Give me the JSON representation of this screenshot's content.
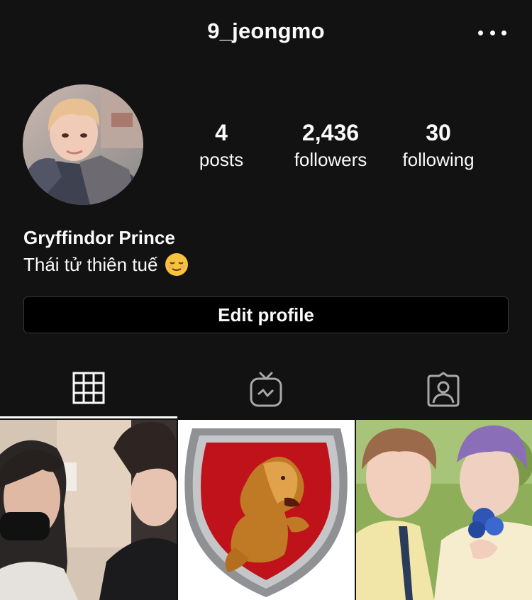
{
  "header": {
    "username": "9_jeongmo",
    "more_icon": "more-horizontal-icon"
  },
  "stats": {
    "posts": {
      "value": "4",
      "label": "posts"
    },
    "followers": {
      "value": "2,436",
      "label": "followers"
    },
    "following": {
      "value": "30",
      "label": "following"
    }
  },
  "profile": {
    "display_name": "Gryffindor Prince",
    "bio": "Thái tử thiên tuế",
    "bio_emoji": "relieved-face-emoji"
  },
  "actions": {
    "edit_profile_label": "Edit profile"
  },
  "tabs": [
    {
      "name": "grid",
      "icon": "grid-icon",
      "active": true
    },
    {
      "name": "igtv",
      "icon": "igtv-icon",
      "active": false
    },
    {
      "name": "tagged",
      "icon": "tagged-person-icon",
      "active": false
    }
  ],
  "posts": [
    {
      "image": "selfie-two-people-office"
    },
    {
      "image": "gryffindor-crest-lion"
    },
    {
      "image": "two-people-holding-blue-flower"
    }
  ],
  "colors": {
    "background": "#121212",
    "text": "#fafafa",
    "button_border": "#363636",
    "crest_red": "#c0121a",
    "emoji_yellow": "#f7c33c"
  }
}
